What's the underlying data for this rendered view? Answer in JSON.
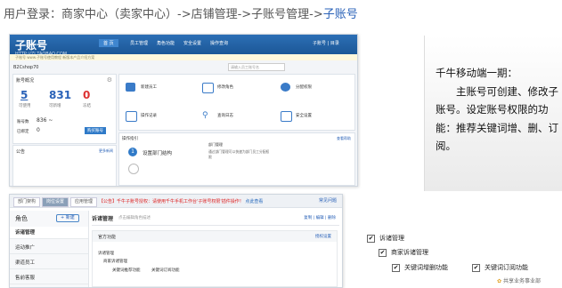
{
  "heading": {
    "prefix": "用户登录：商家中心（卖家中心）->店铺管理->子账号管理->",
    "highlight": "子账号"
  },
  "shot1": {
    "logo": "子账号",
    "logo_sub": "HTTP://ZI.TAOBAO.COM",
    "nav": [
      "首 页",
      "员工管理",
      "角色功能",
      "安全设置",
      "操作查询"
    ],
    "user": "子账号 | 目录",
    "notice": "子账号 www.子账号使用教程 新版本产品介绍方案",
    "crumb": "B2Cshop70",
    "search_placeholder": "请输入员工账号名",
    "overview_title": "账号概况",
    "stats": [
      {
        "num": "5",
        "label": "可使用"
      },
      {
        "num": "831",
        "label": "可新增"
      },
      {
        "num": "0",
        "label": "冻结"
      }
    ],
    "amount_label": "账号数",
    "amount_value": "836 ~",
    "bind_label": "已绑定",
    "bind_value": "0",
    "buy_btn": "购买账号",
    "notice_title": "公告",
    "notice_more": "更多新闻",
    "quick": [
      "新建员工",
      "修改角色",
      "分配权限",
      "操作记录",
      "查询日志",
      "安全设置"
    ],
    "guide_title": "操作指引",
    "guide_more": "查看帮助",
    "step": "1",
    "step_label": "设置部门结构",
    "tip_title": "部门管理",
    "tip_text": "通过部门管理可以快速为部门员工分配权限"
  },
  "bubble": {
    "lines": [
      "千牛移动端一期：",
      "　　主账号可创建、修改子账号。设定账号权限的功能：推荐关键词增、删、订阅。"
    ]
  },
  "shot2": {
    "tabs": [
      "部门架构",
      "岗位设置",
      "应用管理"
    ],
    "warn": "【公告】千牛子账号授权：请使用千牛手机工作台'子账号权限'插件操作！",
    "warn_link": "点此查看",
    "help": "常见问题",
    "side_title": "角色",
    "add": "+ 新建",
    "side_items": [
      "诉诸管理",
      "运动推广",
      "渠道员工",
      "售前客服"
    ],
    "main_title": "诉诸管理",
    "main_desc": "点击编辑角色描述",
    "main_links": "复制 | 编辑 | 删除",
    "perm_title": "官方功能",
    "perm_right": "授权设置",
    "perm_group": "诉诸管理",
    "perm_sub": "商家诉诸管理",
    "perm_a": "关键词推荐功能",
    "perm_b": "关键词订阅功能"
  },
  "tree": {
    "root": "诉诸管理",
    "child": "商家诉诸管理",
    "leaf_a": "关键词增删功能",
    "leaf_b": "关键词订阅功能"
  },
  "brand": "共享业务事业部"
}
